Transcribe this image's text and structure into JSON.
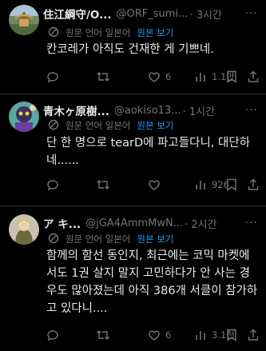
{
  "actions_common": {
    "translate_source": "원문 언어 일본어",
    "translate_link": "원본 보기"
  },
  "tweets": [
    {
      "name": "住江綱守/O...",
      "handle": "@ORF_sumi...",
      "time": "· 3시간",
      "text": "칸코레가 아직도 건재한 게 기쁘네.",
      "reply": "",
      "retweet": "",
      "like": "6",
      "views": "1.1만"
    },
    {
      "name": "青木ヶ原樹...",
      "handle": "@aokiso13...",
      "time": "· 1시간",
      "text": "단 한 명으로 tearD에 파고들다니, 대단하네......",
      "reply": "",
      "retweet": "",
      "like": "",
      "views": "926"
    },
    {
      "name": "ア キ...",
      "handle": "@jGA4AmmMwN...",
      "time": "· 2시간",
      "text": "함께의 함선 동인지, 최근에는 코믹 마켓에서도 1권 살지 말지 고민하다가 안 사는 경우도 많아졌는데 아직 386개 서클이 참가하고 있다니....",
      "reply": "",
      "retweet": "",
      "like": "6",
      "views": "3.1천"
    }
  ],
  "colors": {
    "background": "#000000",
    "text": "#e7e9ea",
    "muted": "#71767b",
    "link": "#1d9bf0",
    "divider": "#2f3336"
  },
  "icons": [
    "more-icon",
    "translate-icon",
    "reply-icon",
    "retweet-icon",
    "like-icon",
    "views-icon",
    "bookmark-icon"
  ]
}
